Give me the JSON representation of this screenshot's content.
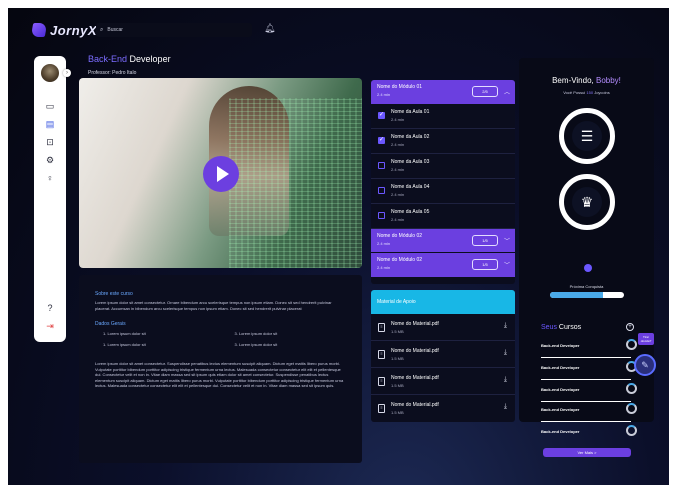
{
  "header": {
    "logo_text": "JornyX",
    "search_placeholder": "Buscar"
  },
  "sidebar": {
    "items": [
      "monitor-icon",
      "book-icon",
      "gamepad-icon",
      "gear-icon",
      "lightbulb-icon"
    ],
    "bottom": [
      "help-icon",
      "logout-icon"
    ]
  },
  "course": {
    "title_highlight": "Back-End",
    "title_rest": "Developer",
    "professor": "Professor: Pedro Italo"
  },
  "description": {
    "about_title": "Sobre este curso",
    "about_text": "Lorem ipsum dolor sit amet consectetur. Ornare bibendum arcu scelerisque tempus non ipsum etiam. Donec sit sed hendrerit pulvinar placerat. Accumsan in bibendum arcu scelerisque tempus non ipsum etiam. Donec sit sed hendrerit pulvinar placerat",
    "general_title": "Dados Gerais",
    "general_items": [
      "1. Lorem ipsum dolor sit",
      "3. Lorem ipsum dolor sit",
      "1. Lorem ipsum dolor sit",
      "3. Lorem ipsum dolor sit"
    ],
    "long_text": "Lorem ipsum dolor sit amet consectetur. Suspendisse penatibus lectus elementum suscipit aliquam. Dictum eget mattis libero purus morbi. Vulputate porttitor bibendum porttitor adipiscing tristique fermentum urna lectus. Malesuada consectetur consectetur elit elit et pellentesque dui. Consectetur velit et non in. Vitae diam massa sed sit ipsum quis etiam dolor sit amet consectetur. Suspendisse penatibus lectus elementum suscipit aliquam. Dictum eget mattis libero purus morbi. Vulputate porttitor bibendum porttitor adipiscing tristique fermentum urna lectus. Malesuada consectetur consectetur elit elit et pellentesque dui. Consectetur velit et non in. Vitae diam massa sed sit ipsum quis."
  },
  "modules": {
    "module1": {
      "name": "Nome do Módulo 01",
      "duration": "2.4 min",
      "progress": "2/5"
    },
    "lessons": [
      {
        "name": "Nome da Aula 01",
        "duration": "2.4 min",
        "done": true
      },
      {
        "name": "Nome da Aula 02",
        "duration": "2.4 min",
        "done": true
      },
      {
        "name": "Nome da Aula 03",
        "duration": "2.4 min",
        "done": false
      },
      {
        "name": "Nome da Aula 04",
        "duration": "2.4 min",
        "done": false
      },
      {
        "name": "Nome da Aula 05",
        "duration": "2.4 min",
        "done": false
      }
    ],
    "module2": {
      "name": "Nome do Módulo 02",
      "duration": "2.4 min",
      "progress": "1/5"
    },
    "module3": {
      "name": "Nome do Módulo 02",
      "duration": "2.4 min",
      "progress": "1/5"
    }
  },
  "materials": {
    "title": "Material de Apoio",
    "items": [
      {
        "name": "Nome do Material.pdf",
        "size": "1.5 MB"
      },
      {
        "name": "Nome do Material.pdf",
        "size": "1.5 MB"
      },
      {
        "name": "Nome do Material.pdf",
        "size": "1.5 MB"
      },
      {
        "name": "Nome do Material.pdf",
        "size": "1.5 MB"
      }
    ]
  },
  "profile": {
    "welcome_prefix": "Bem-Vindo,",
    "user_name": "Bobby!",
    "coins_prefix": "Você Possui",
    "coins_value": "150",
    "coins_suffix": "Joycoins",
    "coin_badge": "150",
    "next_achievement_label": "Próxima Conquista",
    "next_achievement_progress": 0.72,
    "courses_title_hl": "Seus",
    "courses_title_rest": "Cursos",
    "courses": [
      "Back-end Developer",
      "Back-end Developer",
      "Back-end Developer",
      "Back-end Developer",
      "Back-end Developer"
    ],
    "see_more": "Ver Mais >",
    "tip_text": "Tirar dúvida?"
  },
  "colors": {
    "accent": "#6b3fe0",
    "materials_header": "#18b7e6",
    "progress_fill": "#4aa9e8"
  }
}
